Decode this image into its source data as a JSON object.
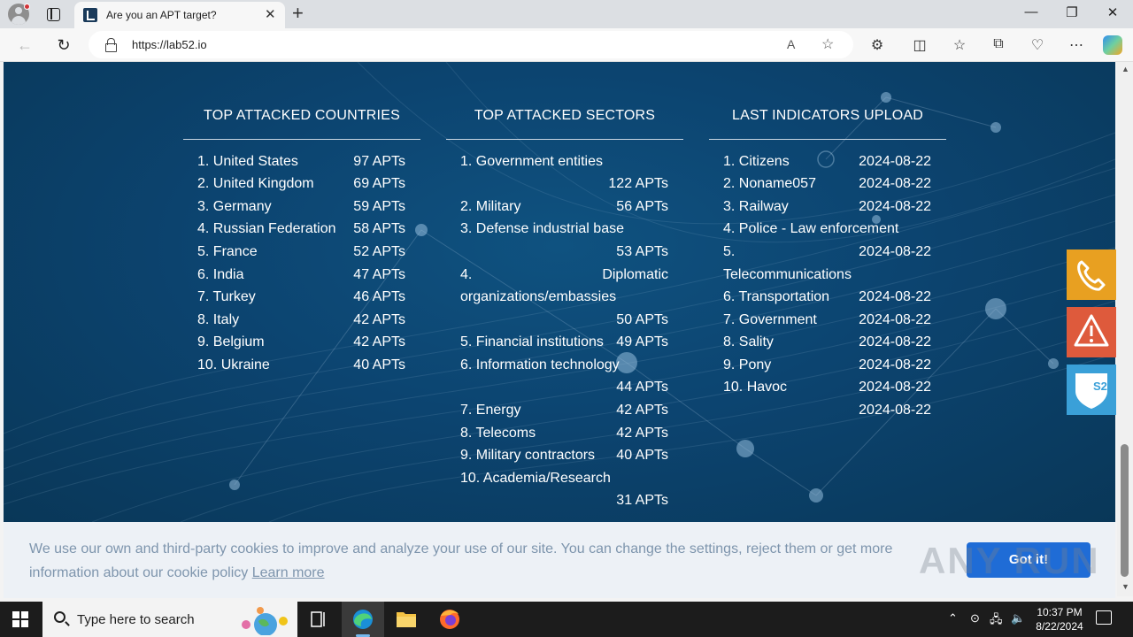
{
  "browser": {
    "tab_title": "Are you an APT target?",
    "tab_close": "✕",
    "new_tab": "+",
    "url": "https://lab52.io",
    "window_controls": {
      "minimize": "—",
      "maximize": "❐",
      "close": "✕"
    }
  },
  "columns": {
    "countries": {
      "title": "TOP ATTACKED COUNTRIES",
      "rows": [
        {
          "name": "1. United States",
          "value": "97 APTs"
        },
        {
          "name": "2. United Kingdom",
          "value": "69 APTs"
        },
        {
          "name": "3. Germany",
          "value": "59 APTs"
        },
        {
          "name": "4. Russian Federation",
          "value": "58 APTs"
        },
        {
          "name": "5. France",
          "value": "52 APTs"
        },
        {
          "name": "6. India",
          "value": "47 APTs"
        },
        {
          "name": "7. Turkey",
          "value": "46 APTs"
        },
        {
          "name": "8. Italy",
          "value": "42 APTs"
        },
        {
          "name": "9. Belgium",
          "value": "42 APTs"
        },
        {
          "name": "10. Ukraine",
          "value": "40 APTs"
        }
      ]
    },
    "sectors": {
      "title": "TOP ATTACKED SECTORS",
      "items": [
        {
          "text": "1. Government entities"
        },
        {
          "text": "122 APTs"
        },
        {
          "text": "2. Military"
        },
        {
          "text": "56 APTs"
        },
        {
          "text": "3. Defense industrial base"
        },
        {
          "text": "53 APTs"
        },
        {
          "text": "4."
        },
        {
          "text": "Diplomatic"
        },
        {
          "text": "organizations/embassies"
        },
        {
          "text": "50 APTs"
        },
        {
          "text": "5. Financial institutions"
        },
        {
          "text": "49 APTs"
        },
        {
          "text": "6. Information technology"
        },
        {
          "text": "44 APTs"
        },
        {
          "text": "7. Energy"
        },
        {
          "text": "42 APTs"
        },
        {
          "text": "8. Telecoms"
        },
        {
          "text": "42 APTs"
        },
        {
          "text": "9. Military contractors"
        },
        {
          "text": "40 APTs"
        },
        {
          "text": "10. Academia/Research"
        },
        {
          "text": "31 APTs"
        }
      ]
    },
    "indicators": {
      "title": "LAST INDICATORS UPLOAD",
      "items": [
        {
          "text": "1. Citizens"
        },
        {
          "text": "2024-08-22"
        },
        {
          "text": "2. Noname057"
        },
        {
          "text": "2024-08-22"
        },
        {
          "text": "3. Railway"
        },
        {
          "text": "2024-08-22"
        },
        {
          "text": "4. Police - Law enforcement"
        },
        {
          "text": "5."
        },
        {
          "text": "2024-08-22"
        },
        {
          "text": "Telecommunications"
        },
        {
          "text": "6. Transportation"
        },
        {
          "text": "2024-08-22"
        },
        {
          "text": "7. Government"
        },
        {
          "text": "2024-08-22"
        },
        {
          "text": "8. Sality"
        },
        {
          "text": "2024-08-22"
        },
        {
          "text": "9. Pony"
        },
        {
          "text": "2024-08-22"
        },
        {
          "text": "10. Havoc"
        },
        {
          "text": "2024-08-22"
        },
        {
          "text": "2024-08-22"
        }
      ]
    }
  },
  "side_buttons": [
    {
      "icon": "phone-icon",
      "color": "#e8a021"
    },
    {
      "icon": "alert-icon",
      "color": "#de5a3c"
    },
    {
      "icon": "s2-shield-icon",
      "color": "#3aa0d8",
      "label": "S2"
    }
  ],
  "cookie": {
    "text": "We use our own and third-party cookies to improve and analyze your use of our site. You can change the settings, reject them or get more information about our cookie policy ",
    "link": "Learn more",
    "button": "Got it!",
    "watermark": "ANY RUN"
  },
  "taskbar": {
    "search_placeholder": "Type here to search",
    "time": "10:37 PM",
    "date": "8/22/2024"
  },
  "colors": {
    "page_bg": "#0c4470",
    "accent_button": "#1f6cd6"
  }
}
